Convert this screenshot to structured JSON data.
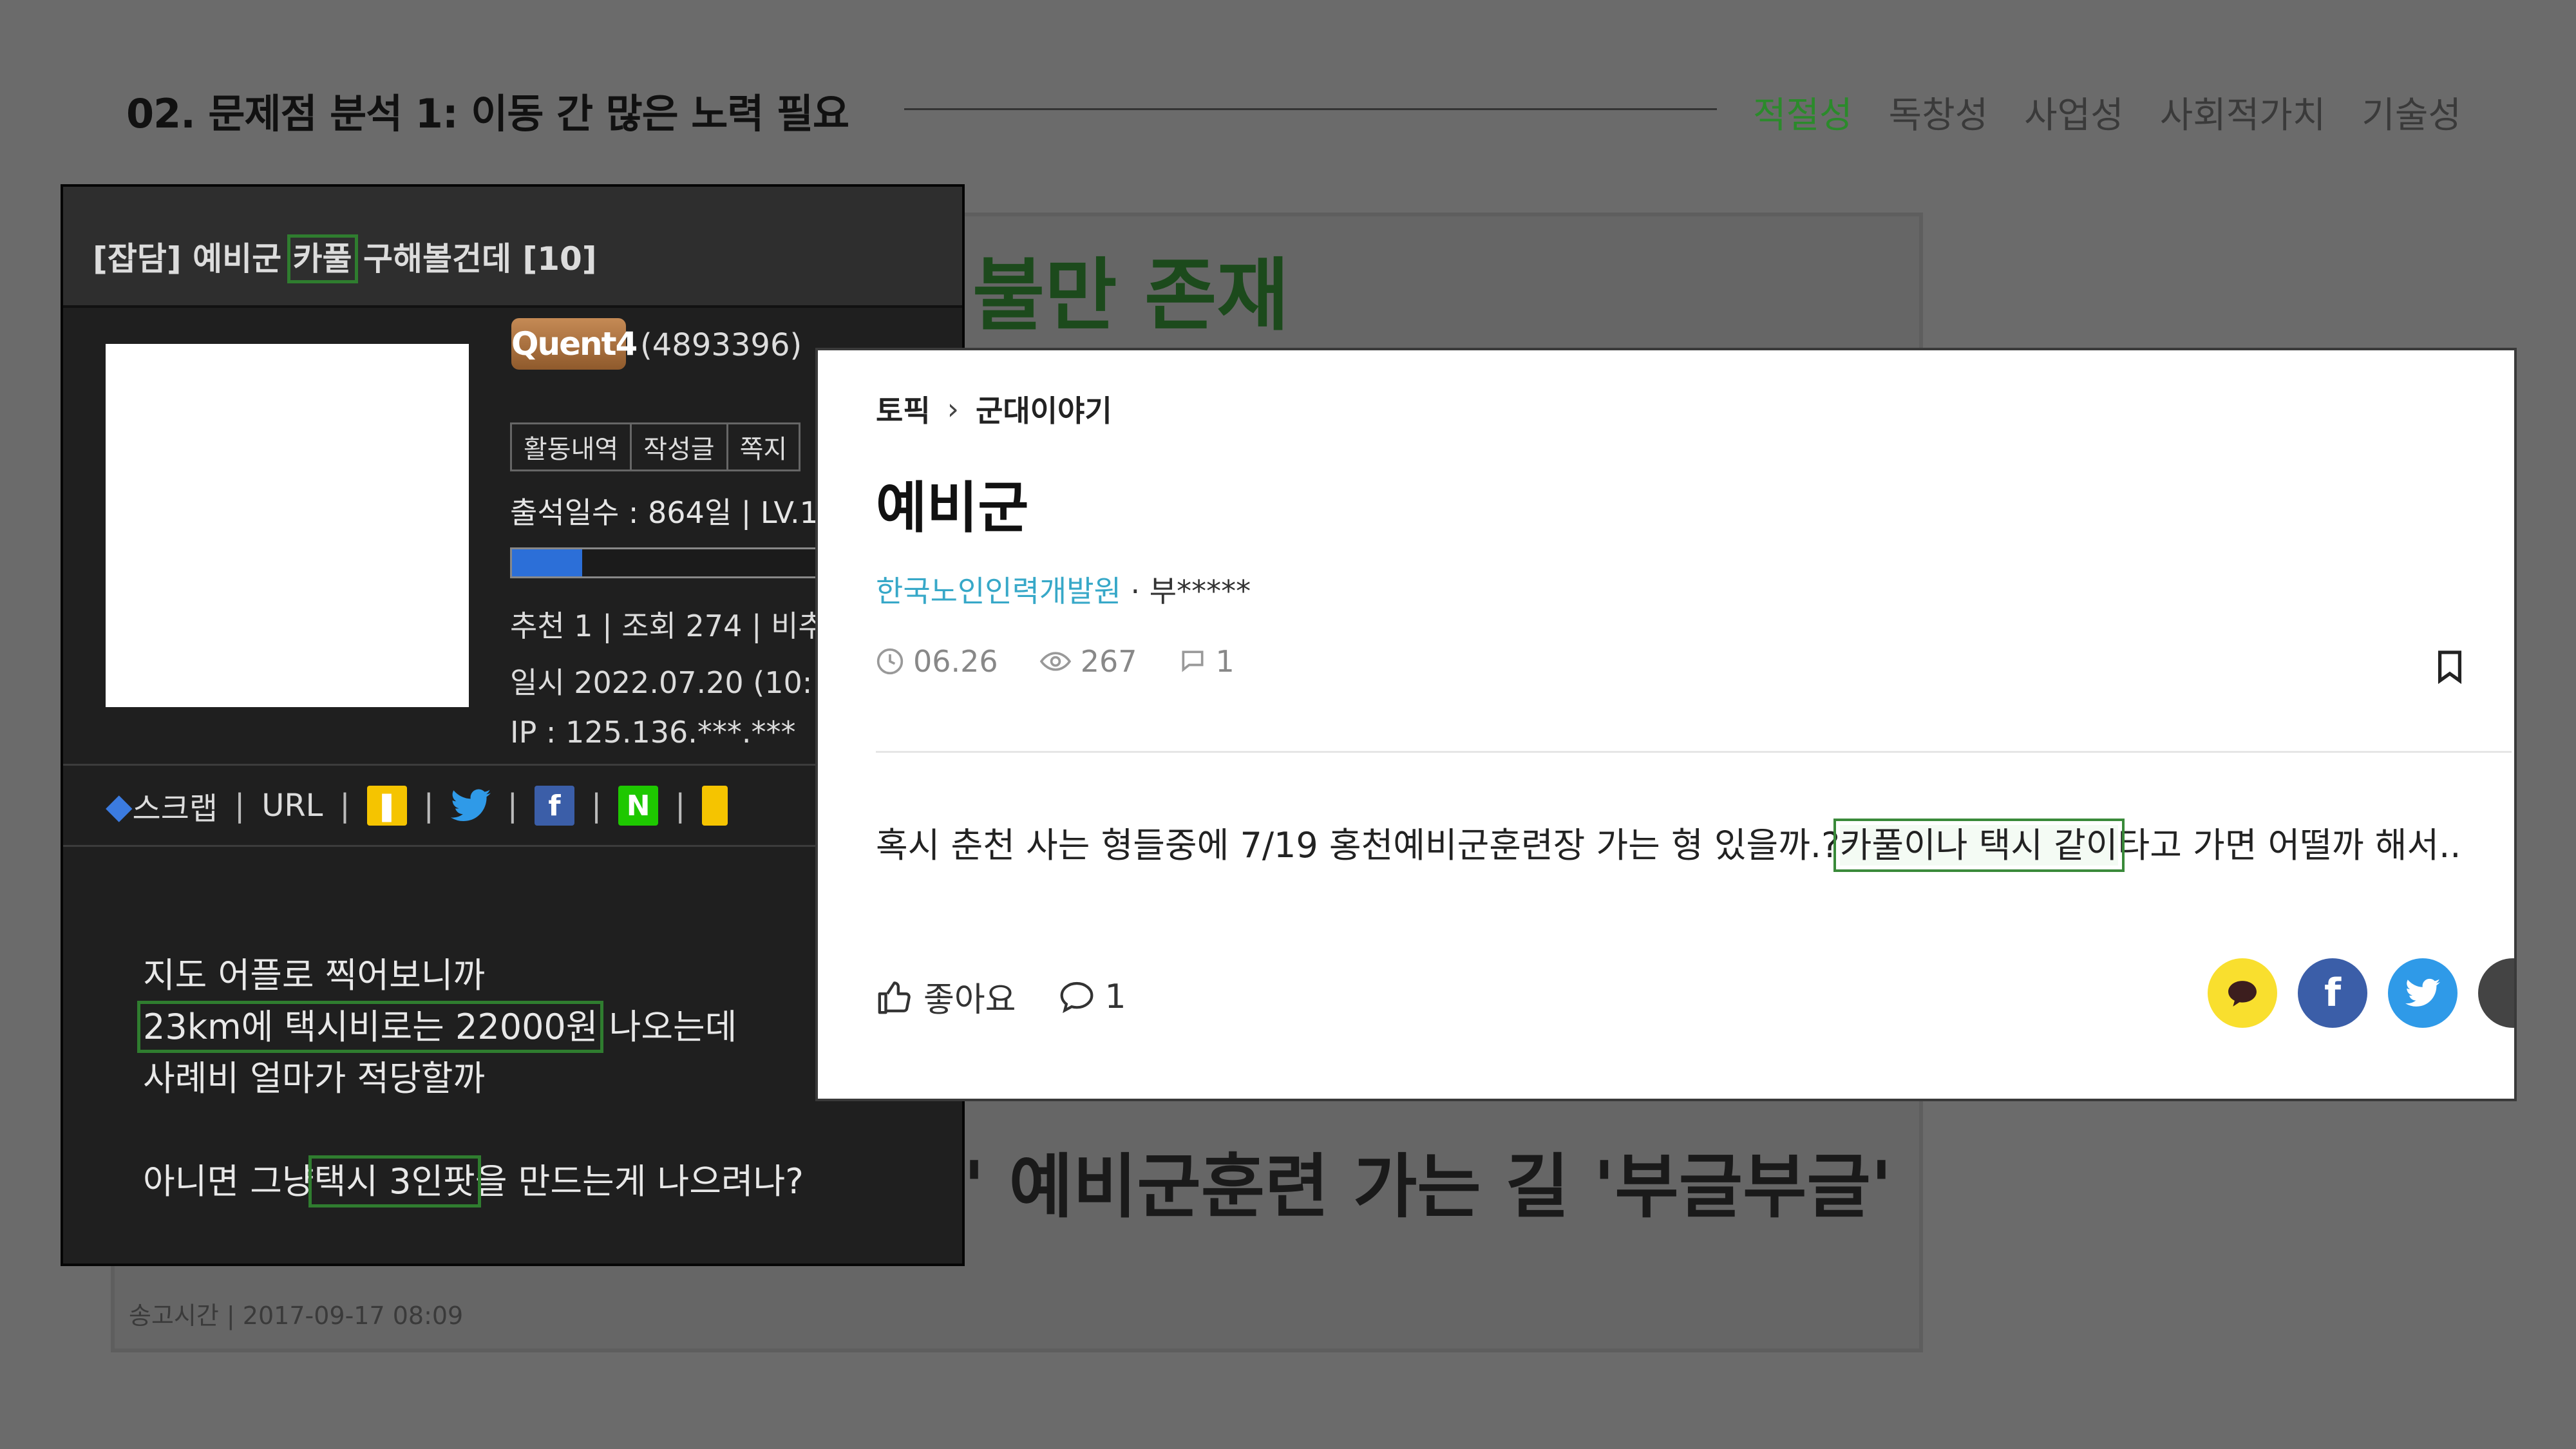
{
  "header": {
    "title": "02. 문제점 분석 1: 이동 간 많은 노력 필요",
    "tabs": [
      {
        "label": "적절성",
        "active": true
      },
      {
        "label": "독창성",
        "active": false
      },
      {
        "label": "사업성",
        "active": false
      },
      {
        "label": "사회적가치",
        "active": false
      },
      {
        "label": "기술성",
        "active": false
      }
    ]
  },
  "colors": {
    "accent_green": "#2b8a2b",
    "highlight_box": "#2f7d2f",
    "progress_blue": "#2c6fd8",
    "author_link": "#37a8c8"
  },
  "background_article": {
    "headline1": "불만 존재",
    "headline2": "' 예비군훈련 가는 길 '부글부글'",
    "date": "송고시간 | 2017-09-17 08:09"
  },
  "forum": {
    "title_prefix": "[잡담] 예비군 ",
    "title_highlight": "카풀",
    "title_suffix": " 구해볼건데 [10]",
    "badge": "Quent4",
    "user_id": "(4893396)",
    "menu": [
      "활동내역",
      "작성글",
      "쪽지"
    ],
    "attendance": "출석일수 : 864일 | LV.1",
    "level_progress": 0.21,
    "stats": "추천 1 | 조회 274 | 비추",
    "datetime": "일시 2022.07.20 (10:",
    "ip": "IP : 125.136.***.***",
    "share_scrap": "스크랩",
    "share_url": "URL",
    "body": {
      "line1": "지도 어플로 찍어보니까",
      "line2_highlight": "23km에 택시비로는 22000원",
      "line2_rest": " 나오는데",
      "line3": "사례비 얼마가 적당할까",
      "line4_pre": "아니면 그냥",
      "line4_highlight": "택시 3인팟",
      "line4_rest": "을 만드는게 나으려나?"
    }
  },
  "post": {
    "crumb_root": "토픽",
    "crumb_child": "군대이야기",
    "title": "예비군",
    "author_company": "한국노인인력개발원",
    "author_name": " · 부*****",
    "date": "06.26",
    "views": "267",
    "comments": "1",
    "text_pre": "혹시 춘천 사는 형들중에 7/19 홍천예비군훈련장 가는 형 있을까.?",
    "text_highlight": "카풀이나 택시 같이",
    "text_post": "타고 가면 어떨까 해서..",
    "like_label": "좋아요",
    "comment_count": "1"
  }
}
